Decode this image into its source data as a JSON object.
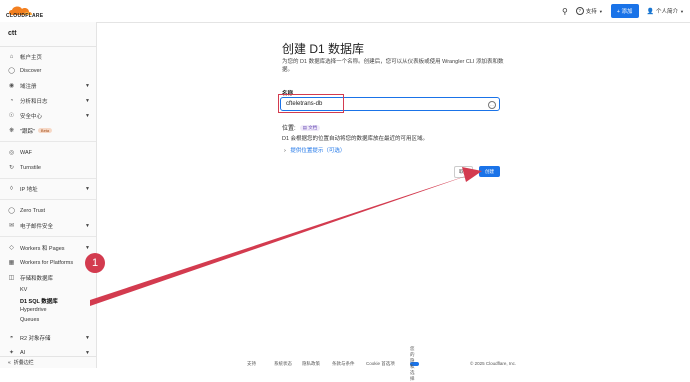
{
  "topbar": {
    "logo_text": "CLOUDFLARE",
    "support_label": "支持",
    "add_label": "+ 添加",
    "account_label": "个人简介"
  },
  "sidebar": {
    "account_name": "ctt",
    "items": [
      {
        "label": "帐户主页",
        "icon": "home-icon"
      },
      {
        "label": "Discover",
        "icon": "bulb-icon"
      },
      {
        "label": "域注册",
        "icon": "globe-icon",
        "expandable": true
      },
      {
        "label": "分析和日志",
        "icon": "chart-icon",
        "expandable": true
      },
      {
        "label": "安全中心",
        "icon": "shield-icon",
        "expandable": true
      },
      {
        "label": "\"跟踪\"",
        "icon": "trace-icon",
        "badge": "Beta"
      },
      {
        "label": "WAF",
        "icon": "waf-icon"
      },
      {
        "label": "Turnstile",
        "icon": "turnstile-icon"
      },
      {
        "label": "IP 地址",
        "icon": "ip-icon",
        "expandable": true
      },
      {
        "label": "Zero Trust",
        "icon": "zerotrust-icon"
      },
      {
        "label": "电子邮件安全",
        "icon": "mail-icon",
        "expandable": true
      },
      {
        "label": "Workers 和 Pages",
        "icon": "workers-icon",
        "expandable": true
      },
      {
        "label": "Workers for Platforms",
        "icon": "platforms-icon"
      },
      {
        "label": "存储和数据库",
        "icon": "database-icon",
        "expandable": true
      },
      {
        "label": "R2 对象存储",
        "icon": "bucket-icon",
        "expandable": true
      },
      {
        "label": "AI",
        "icon": "ai-icon",
        "expandable": true
      }
    ],
    "storage_sub_items": [
      "KV",
      "D1 SQL 数据库",
      "Hyperdrive",
      "Queues"
    ],
    "active_sub_item": "D1 SQL 数据库",
    "bottom_label": "折叠边栏"
  },
  "main": {
    "title": "创建 D1 数据库",
    "description": "为您的 D1 数据库选择一个名称。创建后，您可以从仪表板或使用 Wrangler CLI 添加表和数据。",
    "name_label": "名称",
    "name_value": "cfteletrans-db",
    "location_label": "位置:",
    "location_doc_tag": "文档",
    "location_desc": "D1 会根据您的位置自动将您的数据库放在最近的可用区域。",
    "location_hint_link": "提供位置提示（可选）",
    "cancel_label": "取消",
    "create_label": "创建"
  },
  "footer": {
    "links": [
      "支持",
      "系统状态",
      "隐私政策",
      "条款与条件",
      "Cookie 首选项",
      "您的隐私选择"
    ],
    "copyright": "© 2025 Cloudflare, Inc."
  },
  "annotation": {
    "step_number": "1",
    "color": "#d33b4f"
  },
  "colors": {
    "accent": "#1a73e8",
    "highlight": "#d33b4f"
  }
}
